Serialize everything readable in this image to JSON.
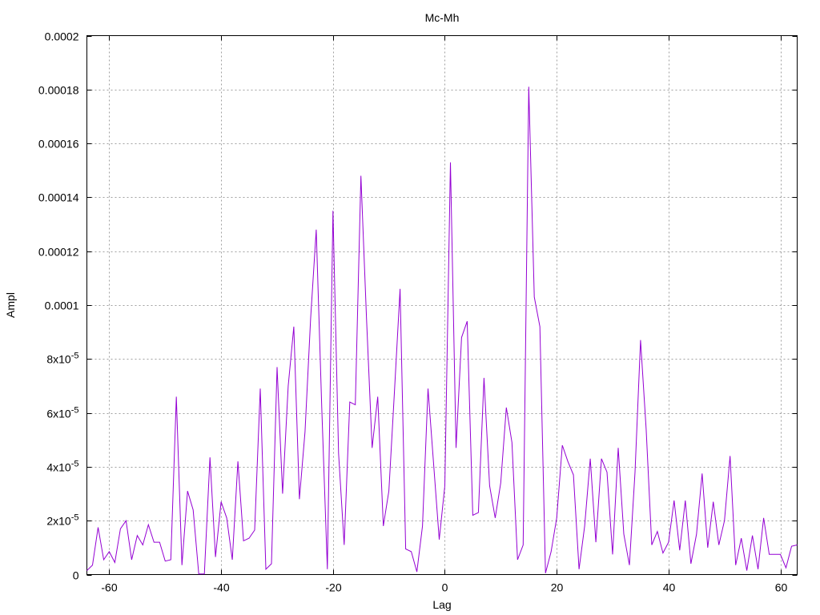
{
  "chart_data": {
    "type": "line",
    "title": "Mc-Mh",
    "xlabel": "Lag",
    "ylabel": "Ampl",
    "xlim": [
      -64,
      63
    ],
    "ylim": [
      0,
      0.0002
    ],
    "grid": true,
    "legend": "none",
    "line_color": "#9400d3",
    "xticks": [
      {
        "value": -60,
        "label": "-60"
      },
      {
        "value": -40,
        "label": "-40"
      },
      {
        "value": -20,
        "label": "-20"
      },
      {
        "value": 0,
        "label": "0"
      },
      {
        "value": 20,
        "label": "20"
      },
      {
        "value": 40,
        "label": "40"
      },
      {
        "value": 60,
        "label": "60"
      }
    ],
    "yticks": [
      {
        "value": 0,
        "label": "0",
        "mantissa": "0",
        "exp": ""
      },
      {
        "value": 2e-05,
        "label": "2x10-5",
        "mantissa": "2x10",
        "exp": "-5"
      },
      {
        "value": 4e-05,
        "label": "4x10-5",
        "mantissa": "4x10",
        "exp": "-5"
      },
      {
        "value": 6e-05,
        "label": "6x10-5",
        "mantissa": "6x10",
        "exp": "-5"
      },
      {
        "value": 8e-05,
        "label": "8x10-5",
        "mantissa": "8x10",
        "exp": "-5"
      },
      {
        "value": 0.0001,
        "label": "0.0001",
        "mantissa": "0.0001",
        "exp": ""
      },
      {
        "value": 0.00012,
        "label": "0.00012",
        "mantissa": "0.00012",
        "exp": ""
      },
      {
        "value": 0.00014,
        "label": "0.00014",
        "mantissa": "0.00014",
        "exp": ""
      },
      {
        "value": 0.00016,
        "label": "0.00016",
        "mantissa": "0.00016",
        "exp": ""
      },
      {
        "value": 0.00018,
        "label": "0.00018",
        "mantissa": "0.00018",
        "exp": ""
      },
      {
        "value": 0.0002,
        "label": "0.0002",
        "mantissa": "0.0002",
        "exp": ""
      }
    ],
    "series": [
      {
        "x": [
          -64,
          -63,
          -62,
          -61,
          -60,
          -59,
          -58,
          -57,
          -56,
          -55,
          -54,
          -53,
          -52,
          -51,
          -50,
          -49,
          -48,
          -47,
          -46,
          -45,
          -44,
          -43,
          -42,
          -41,
          -40,
          -39,
          -38,
          -37,
          -36,
          -35,
          -34,
          -33,
          -32,
          -31,
          -30,
          -29,
          -28,
          -27,
          -26,
          -25,
          -24,
          -23,
          -22,
          -21,
          -20,
          -19,
          -18,
          -17,
          -16,
          -15,
          -14,
          -13,
          -12,
          -11,
          -10,
          -9,
          -8,
          -7,
          -6,
          -5,
          -4,
          -3,
          -2,
          -1,
          0,
          1,
          2,
          3,
          4,
          5,
          6,
          7,
          8,
          9,
          10,
          11,
          12,
          13,
          14,
          15,
          16,
          17,
          18,
          19,
          20,
          21,
          22,
          23,
          24,
          25,
          26,
          27,
          28,
          29,
          30,
          31,
          32,
          33,
          34,
          35,
          36,
          37,
          38,
          39,
          40,
          41,
          42,
          43,
          44,
          45,
          46,
          47,
          48,
          49,
          50,
          51,
          52,
          53,
          54,
          55,
          56,
          57,
          58,
          59,
          60,
          61,
          62,
          63
        ],
        "values": [
          1.5e-06,
          3.5e-06,
          1.75e-05,
          5.5e-06,
          8.5e-06,
          4.5e-06,
          1.7e-05,
          2e-05,
          5.5e-06,
          1.45e-05,
          1.1e-05,
          1.85e-05,
          1.2e-05,
          1.2e-05,
          5e-06,
          5.5e-06,
          6.6e-05,
          3.5e-06,
          3.1e-05,
          2.4e-05,
          2e-07,
          2e-07,
          4.35e-05,
          6.5e-06,
          2.7e-05,
          2.1e-05,
          5.5e-06,
          4.2e-05,
          1.25e-05,
          1.35e-05,
          1.65e-05,
          6.9e-05,
          2e-06,
          4e-06,
          7.7e-05,
          3e-05,
          7e-05,
          9.2e-05,
          2.8e-05,
          5.3e-05,
          9.5e-05,
          0.000128,
          6.2e-05,
          2e-06,
          0.000135,
          4.5e-05,
          1.1e-05,
          6.4e-05,
          6.3e-05,
          0.000148,
          9.5e-05,
          4.7e-05,
          6.6e-05,
          1.8e-05,
          3.1e-05,
          6.8e-05,
          0.000106,
          9.5e-06,
          8.5e-06,
          1e-06,
          1.8e-05,
          6.9e-05,
          4.1e-05,
          1.3e-05,
          3.3e-05,
          0.000153,
          4.7e-05,
          8.8e-05,
          9.4e-05,
          2.2e-05,
          2.3e-05,
          7.3e-05,
          3.3e-05,
          2.1e-05,
          3.4e-05,
          6.2e-05,
          4.9e-05,
          5.5e-06,
          1.1e-05,
          0.000181,
          0.000103,
          9.2e-05,
          5e-07,
          8.5e-06,
          2.1e-05,
          4.8e-05,
          4.2e-05,
          3.7e-05,
          2e-06,
          1.8e-05,
          4.3e-05,
          1.2e-05,
          4.3e-05,
          3.8e-05,
          7.5e-06,
          4.7e-05,
          1.5e-05,
          3.5e-06,
          3.8e-05,
          8.7e-05,
          5.4e-05,
          1.1e-05,
          1.6e-05,
          8e-06,
          1.2e-05,
          2.75e-05,
          9e-06,
          2.75e-05,
          4e-06,
          1.5e-05,
          3.75e-05,
          1e-05,
          2.7e-05,
          1.1e-05,
          2e-05,
          4.4e-05,
          3.5e-06,
          1.35e-05,
          1.5e-06,
          1.45e-05,
          2e-06,
          2.1e-05,
          7.5e-06,
          7.5e-06,
          7.5e-06,
          2.5e-06,
          1.05e-05,
          1.1e-05
        ]
      }
    ]
  }
}
